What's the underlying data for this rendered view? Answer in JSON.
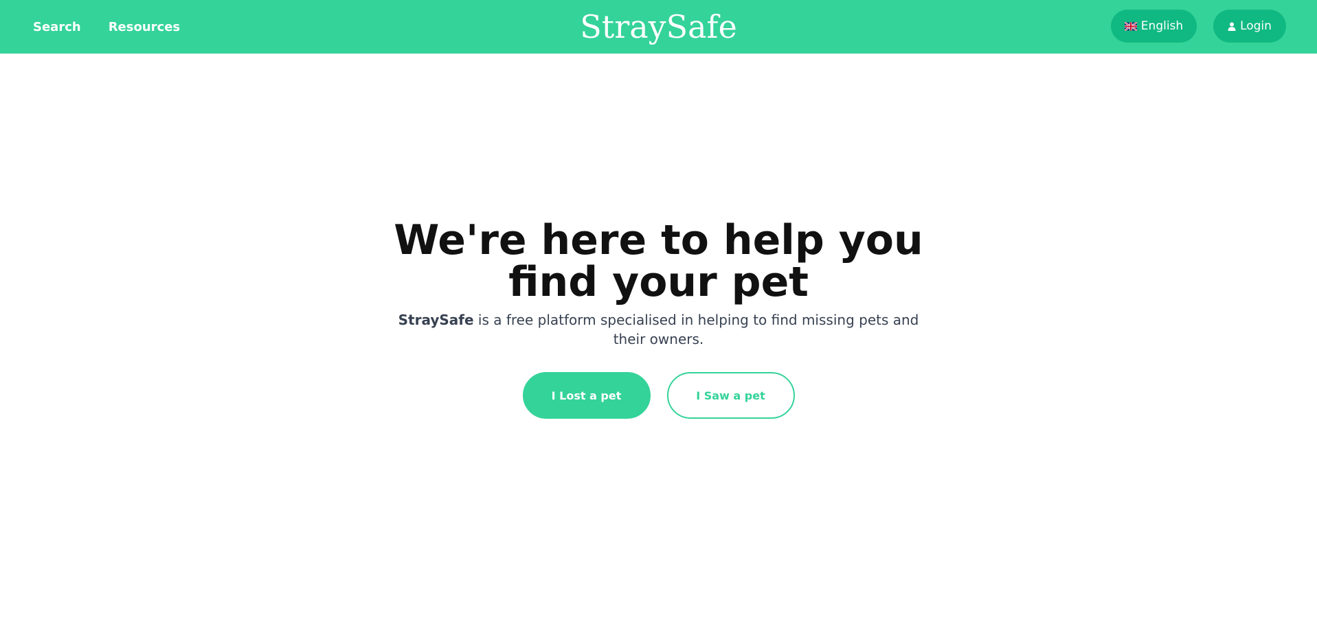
{
  "header": {
    "nav": [
      {
        "label": "Search"
      },
      {
        "label": "Resources"
      }
    ],
    "brand": "StraySafe",
    "language_label": "English",
    "login_label": "Login"
  },
  "hero": {
    "title": "We're here to help you find your pet",
    "subtitle_brand": "StraySafe",
    "subtitle_rest": " is a free platform specialised in helping to find missing pets and their owners.",
    "primary_cta": "I Lost a pet",
    "secondary_cta": "I Saw a pet"
  },
  "colors": {
    "brand_green": "#34d399",
    "button_green": "#10b981"
  },
  "icons": {
    "language": "uk-flag-icon",
    "login": "user-icon"
  }
}
